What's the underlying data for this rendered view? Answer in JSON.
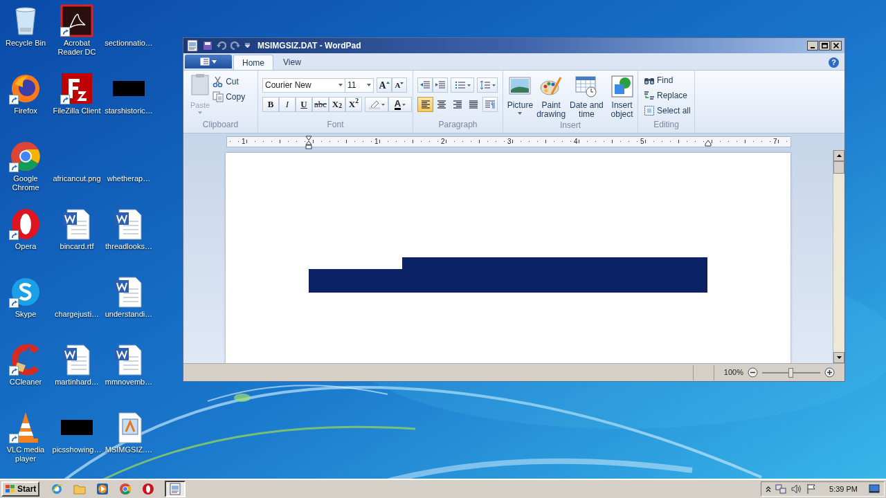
{
  "desktop_icons": [
    {
      "label": "Recycle Bin",
      "kind": "recycle",
      "shortcut": false
    },
    {
      "label": "Acrobat Reader DC",
      "kind": "acrobat",
      "shortcut": true
    },
    {
      "label": "sectionnatio…",
      "kind": "blank",
      "shortcut": false
    },
    {
      "label": "Firefox",
      "kind": "firefox",
      "shortcut": true
    },
    {
      "label": "FileZilla Client",
      "kind": "filezilla",
      "shortcut": true
    },
    {
      "label": "starshistoric…",
      "kind": "black",
      "shortcut": false
    },
    {
      "label": "Google Chrome",
      "kind": "chrome",
      "shortcut": true
    },
    {
      "label": "africancut.png",
      "kind": "blank",
      "shortcut": false
    },
    {
      "label": "whetherap…",
      "kind": "blank",
      "shortcut": false
    },
    {
      "label": "Opera",
      "kind": "opera",
      "shortcut": true
    },
    {
      "label": "bincard.rtf",
      "kind": "word",
      "shortcut": false
    },
    {
      "label": "threadlooks…",
      "kind": "word",
      "shortcut": false
    },
    {
      "label": "Skype",
      "kind": "skype",
      "shortcut": true
    },
    {
      "label": "chargejusti…",
      "kind": "blank",
      "shortcut": false
    },
    {
      "label": "understandi…",
      "kind": "word",
      "shortcut": false
    },
    {
      "label": "CCleaner",
      "kind": "ccleaner",
      "shortcut": true
    },
    {
      "label": "martinhard…",
      "kind": "word",
      "shortcut": false
    },
    {
      "label": "mmnovemb…",
      "kind": "word",
      "shortcut": false
    },
    {
      "label": "VLC media player",
      "kind": "vlc",
      "shortcut": true
    },
    {
      "label": "picsshowing…",
      "kind": "black",
      "shortcut": false
    },
    {
      "label": "MSIMGSIZ.…",
      "kind": "wordpad",
      "shortcut": false
    }
  ],
  "window": {
    "title": "MSIMGSIZ.DAT - WordPad",
    "tabs": [
      {
        "label": "Home",
        "selected": true
      },
      {
        "label": "View",
        "selected": false
      }
    ],
    "help": "?",
    "ribbon": {
      "clipboard": {
        "group": "Clipboard",
        "paste": {
          "label": "Paste",
          "disabled": true
        },
        "actions": [
          {
            "label": "Cut",
            "kind": "cut"
          },
          {
            "label": "Copy",
            "kind": "copy"
          }
        ]
      },
      "font": {
        "group": "Font",
        "family": "Courier New",
        "size": "11",
        "grow": "A",
        "shrink": "A",
        "styles": [
          {
            "label": "B",
            "kind": "bold"
          },
          {
            "label": "I",
            "kind": "italic"
          },
          {
            "label": "U",
            "kind": "underline"
          },
          {
            "label": "abc",
            "kind": "strike"
          },
          {
            "label": "X$_{2}$",
            "kind": "sub"
          },
          {
            "label": "X$^{2}$",
            "kind": "sup"
          }
        ],
        "color_label": "A"
      },
      "paragraph": {
        "group": "Paragraph",
        "align": [
          {
            "kind": "left",
            "selected": true
          },
          {
            "kind": "center",
            "selected": false
          },
          {
            "kind": "right",
            "selected": false
          },
          {
            "kind": "justify",
            "selected": false
          }
        ]
      },
      "insert": {
        "group": "Insert",
        "items": [
          {
            "label": "Picture",
            "kind": "picture",
            "dropdown": true
          },
          {
            "label": "Paint drawing",
            "kind": "paint",
            "dropdown": false
          },
          {
            "label": "Date and time",
            "kind": "datetime",
            "dropdown": false
          },
          {
            "label": "Insert object",
            "kind": "object",
            "dropdown": false
          }
        ]
      },
      "editing": {
        "group": "Editing",
        "items": [
          {
            "label": "Find",
            "kind": "find"
          },
          {
            "label": "Replace",
            "kind": "replace"
          },
          {
            "label": "Select all",
            "kind": "select"
          }
        ]
      }
    },
    "ruler": [
      "1",
      "1",
      "2",
      "3",
      "4",
      "5",
      "7"
    ],
    "status_bar": {
      "zoom": {
        "reading": "100%",
        "level": 0.5
      }
    }
  },
  "taskbar": {
    "start": "Start",
    "apps": [
      {
        "kind": "ie",
        "selected": false
      },
      {
        "kind": "explorer",
        "selected": false
      },
      {
        "kind": "media",
        "selected": false
      },
      {
        "kind": "chrome",
        "selected": false
      },
      {
        "kind": "opera",
        "selected": false
      },
      {
        "kind": "wordpad",
        "selected": true
      }
    ],
    "clock": "5:39 PM"
  }
}
